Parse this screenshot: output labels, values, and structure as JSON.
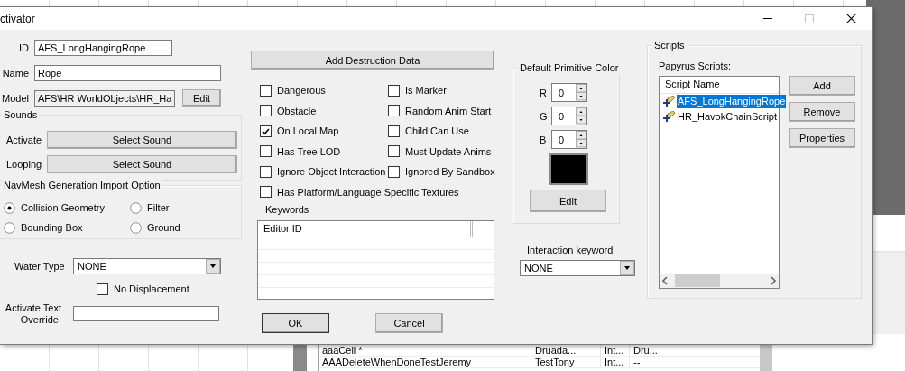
{
  "window": {
    "title": "ctivator",
    "maximize_disabled": true
  },
  "id": {
    "label": "ID",
    "value": "AFS_LongHangingRope"
  },
  "name": {
    "label": "Name",
    "value": "Rope"
  },
  "model": {
    "label": "Model",
    "value": "AFS\\HR WorldObjects\\HR_Ha",
    "button": "Edit"
  },
  "sounds": {
    "title": "Sounds",
    "rows": [
      {
        "label": "Activate",
        "button": "Select Sound"
      },
      {
        "label": "Looping",
        "button": "Select Sound"
      }
    ]
  },
  "navmesh": {
    "title": "NavMesh Generation Import Option",
    "options": [
      {
        "label": "Collision Geometry",
        "selected": true
      },
      {
        "label": "Filter",
        "selected": false
      },
      {
        "label": "Bounding Box",
        "selected": false
      },
      {
        "label": "Ground",
        "selected": false
      }
    ]
  },
  "water_type": {
    "label": "Water Type",
    "value": "NONE"
  },
  "no_displacement": {
    "label": "No Displacement",
    "checked": false
  },
  "activate_text_override": {
    "label": "Activate Text Override:"
  },
  "destruction_button": "Add Destruction Data",
  "flags": [
    {
      "label": "Dangerous",
      "checked": false
    },
    {
      "label": "Is Marker",
      "checked": false
    },
    {
      "label": "Obstacle",
      "checked": false
    },
    {
      "label": "Random Anim Start",
      "checked": false
    },
    {
      "label": "On Local Map",
      "checked": true
    },
    {
      "label": "Child Can Use",
      "checked": false
    },
    {
      "label": "Has Tree LOD",
      "checked": false
    },
    {
      "label": "Must Update Anims",
      "checked": false
    },
    {
      "label": "Ignore Object Interaction",
      "checked": false
    },
    {
      "label": "Ignored By Sandbox",
      "checked": false
    },
    {
      "label": "Has Platform/Language Specific Textures",
      "checked": false
    }
  ],
  "keywords": {
    "label": "Keywords",
    "columns": [
      "Editor ID"
    ]
  },
  "buttons": [
    "OK",
    "Cancel"
  ],
  "primitive_color": {
    "title": "Default Primitive Color",
    "channels": [
      {
        "label": "R",
        "value": "0"
      },
      {
        "label": "G",
        "value": "0"
      },
      {
        "label": "B",
        "value": "0"
      }
    ],
    "color": "#000000",
    "button": "Edit"
  },
  "interaction_keyword": {
    "label": "Interaction keyword",
    "value": "NONE"
  },
  "scripts": {
    "title": "Scripts",
    "list_label": "Papyrus Scripts:",
    "columns": [
      "Script Name"
    ],
    "items": [
      {
        "name": "AFS_LongHangingRope",
        "selected": true
      },
      {
        "name": "HR_HavokChainScript",
        "selected": false
      }
    ],
    "buttons": [
      "Add",
      "Remove",
      "Properties"
    ]
  },
  "background_list": {
    "rows": [
      {
        "cells": [
          "aaaCell *",
          "Druada...",
          "Int...",
          "Dru..."
        ]
      },
      {
        "cells": [
          "AAADeleteWhenDoneTestJeremy",
          "TestTony",
          "Int...",
          "--"
        ]
      }
    ]
  }
}
